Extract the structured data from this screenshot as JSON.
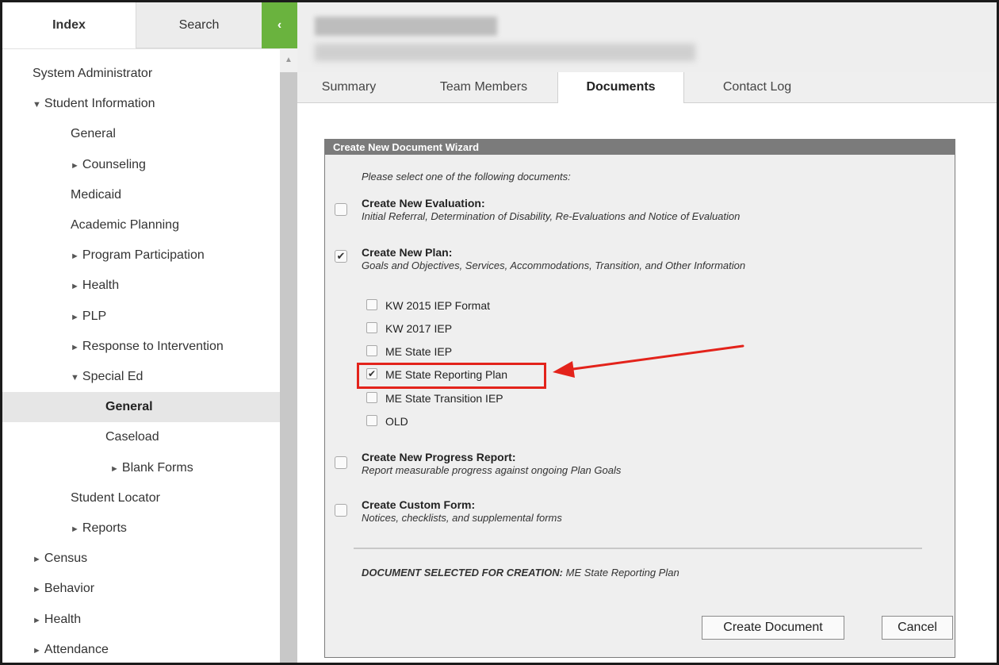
{
  "left_tabs": {
    "index": "Index",
    "search": "Search",
    "collapse": "‹"
  },
  "tree": [
    {
      "label": "System Administrator",
      "arrow": "",
      "indent": 38,
      "selected": false
    },
    {
      "label": "Student Information",
      "arrow": "▼",
      "indent": 38,
      "selected": false
    },
    {
      "label": "General",
      "arrow": "",
      "indent": 86,
      "selected": false
    },
    {
      "label": "Counseling",
      "arrow": "►",
      "indent": 86,
      "selected": false
    },
    {
      "label": "Medicaid",
      "arrow": "",
      "indent": 86,
      "selected": false
    },
    {
      "label": "Academic Planning",
      "arrow": "",
      "indent": 86,
      "selected": false
    },
    {
      "label": "Program Participation",
      "arrow": "►",
      "indent": 86,
      "selected": false
    },
    {
      "label": "Health",
      "arrow": "►",
      "indent": 86,
      "selected": false
    },
    {
      "label": "PLP",
      "arrow": "►",
      "indent": 86,
      "selected": false
    },
    {
      "label": "Response to Intervention",
      "arrow": "►",
      "indent": 86,
      "selected": false
    },
    {
      "label": "Special Ed",
      "arrow": "▼",
      "indent": 86,
      "selected": false
    },
    {
      "label": "General",
      "arrow": "",
      "indent": 130,
      "selected": true
    },
    {
      "label": "Caseload",
      "arrow": "",
      "indent": 130,
      "selected": false
    },
    {
      "label": "Blank Forms",
      "arrow": "►",
      "indent": 136,
      "selected": false
    },
    {
      "label": "Student Locator",
      "arrow": "",
      "indent": 86,
      "selected": false
    },
    {
      "label": "Reports",
      "arrow": "►",
      "indent": 86,
      "selected": false
    },
    {
      "label": "Census",
      "arrow": "►",
      "indent": 38,
      "selected": false
    },
    {
      "label": "Behavior",
      "arrow": "►",
      "indent": 38,
      "selected": false
    },
    {
      "label": "Health",
      "arrow": "►",
      "indent": 38,
      "selected": false
    },
    {
      "label": "Attendance",
      "arrow": "►",
      "indent": 38,
      "selected": false
    }
  ],
  "tabs": {
    "summary": "Summary",
    "team_members": "Team Members",
    "documents": "Documents",
    "contact_log": "Contact Log"
  },
  "wizard": {
    "title": "Create New Document Wizard",
    "prompt": "Please select one of the following documents:",
    "evaluation": {
      "title": "Create New Evaluation:",
      "desc": "Initial Referral, Determination of Disability, Re-Evaluations and Notice of Evaluation",
      "checked": false
    },
    "plan": {
      "title": "Create New Plan:",
      "desc": "Goals and Objectives, Services, Accommodations, Transition, and Other Information",
      "checked": true
    },
    "sub_options": [
      {
        "label": "KW 2015 IEP Format",
        "checked": false
      },
      {
        "label": "KW 2017 IEP",
        "checked": false
      },
      {
        "label": "ME State IEP",
        "checked": false
      },
      {
        "label": "ME State Reporting Plan",
        "checked": true
      },
      {
        "label": "ME State Transition IEP",
        "checked": false
      },
      {
        "label": "OLD",
        "checked": false
      }
    ],
    "progress": {
      "title": "Create New Progress Report:",
      "desc": "Report measurable progress against ongoing Plan Goals",
      "checked": false
    },
    "custom": {
      "title": "Create Custom Form:",
      "desc": "Notices, checklists, and supplemental forms",
      "checked": false
    },
    "selected_label": "DOCUMENT SELECTED FOR CREATION:",
    "selected_value": "ME State Reporting Plan",
    "create_button": "Create Document",
    "cancel_button": "Cancel"
  },
  "colors": {
    "accent_green": "#6ab33e",
    "highlight_red": "#e3231b",
    "wizard_header": "#7b7b7b"
  },
  "icons": {
    "check": "check-icon",
    "collapse": "chevron-left-icon",
    "arrow": "red-arrow-annotation"
  }
}
